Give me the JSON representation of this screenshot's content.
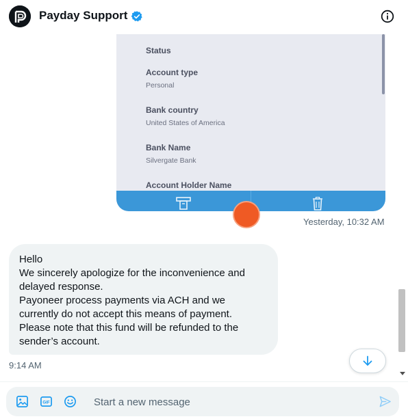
{
  "header": {
    "title": "Payday Support",
    "avatar_icon": "payoneer-logo-icon",
    "verified_icon": "verified-badge-icon",
    "info_icon": "info-icon"
  },
  "colors": {
    "accent": "#1d9bf0",
    "bubble": "#eff3f4",
    "card_toolbar": "#3b97d8",
    "text_secondary": "#536471"
  },
  "image_card": {
    "fields": [
      {
        "label": "Status",
        "value": ""
      },
      {
        "label": "Account type",
        "value": "Personal"
      },
      {
        "label": "Bank country",
        "value": "United States of America"
      },
      {
        "label": "Bank Name",
        "value": "Silvergate Bank"
      },
      {
        "label": "Account Holder Name",
        "value": ""
      }
    ],
    "toolbar_icons": [
      "atm-icon",
      "trash-icon"
    ]
  },
  "messages": [
    {
      "side": "right",
      "type": "image",
      "timestamp": "Yesterday, 10:32 AM"
    },
    {
      "side": "left",
      "type": "text",
      "text": "Hello\nWe sincerely apologize for the inconvenience and delayed response.\nPayoneer process payments via ACH and we currently do not accept this means of payment.\nPlease note that this fund will be refunded to the sender’s account.",
      "timestamp": "9:14 AM"
    }
  ],
  "composer": {
    "placeholder": "Start a new message",
    "icons": [
      "image-icon",
      "gif-icon",
      "emoji-icon",
      "send-icon"
    ]
  }
}
